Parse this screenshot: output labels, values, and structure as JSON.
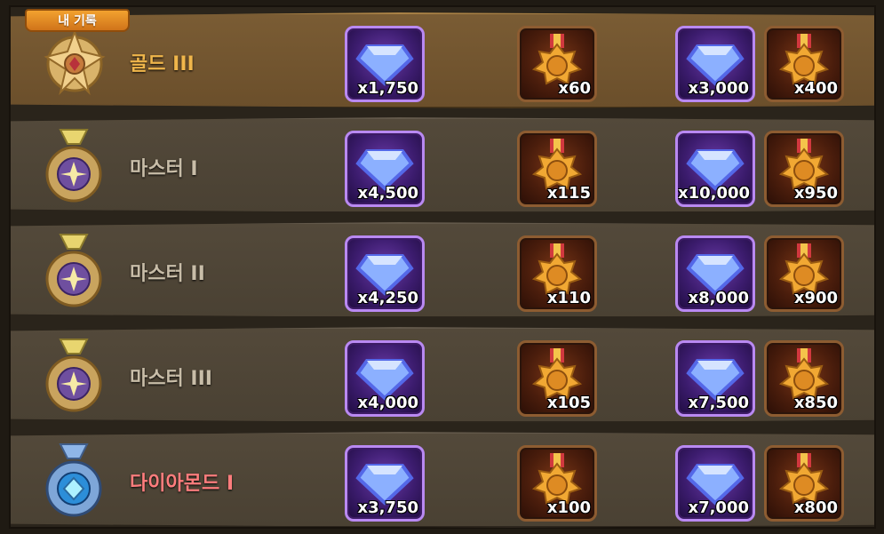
{
  "badge_label": "내 기록",
  "rows": [
    {
      "tier": "골드 III",
      "r1": "x1,750",
      "r2": "x60",
      "r3": "x3,000",
      "r4": "x400"
    },
    {
      "tier": "마스터 I",
      "r1": "x4,500",
      "r2": "x115",
      "r3": "x10,000",
      "r4": "x950"
    },
    {
      "tier": "마스터 II",
      "r1": "x4,250",
      "r2": "x110",
      "r3": "x8,000",
      "r4": "x900"
    },
    {
      "tier": "마스터 III",
      "r1": "x4,000",
      "r2": "x105",
      "r3": "x7,500",
      "r4": "x850"
    },
    {
      "tier": "다이아몬드 I",
      "r1": "x3,750",
      "r2": "x100",
      "r3": "x7,000",
      "r4": "x800"
    }
  ],
  "icons": {
    "gem": "blue-diamond-icon",
    "medal": "arena-medal-icon",
    "tier_gold": "gold-tier-medal-icon",
    "tier_master": "master-tier-medal-icon",
    "tier_diamond": "diamond-tier-medal-icon"
  },
  "colors": {
    "highlight_row": "#6b4f2b",
    "gold_text": "#f0b64b",
    "master_text": "#c8bda8",
    "diamond_text": "#ff7d7d",
    "gem_border": "#b989f2",
    "medal_border": "#8d5c31"
  }
}
